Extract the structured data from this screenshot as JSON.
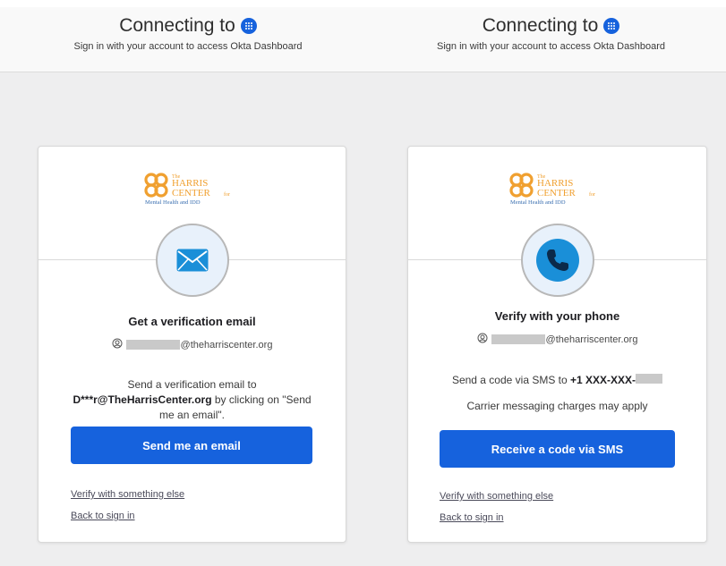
{
  "colors": {
    "accent": "#1662dd",
    "page_bg": "#eeeeef",
    "header_bg": "#f9f9f9"
  },
  "left": {
    "header": {
      "title": "Connecting to",
      "subtitle": "Sign in with your account to access Okta Dashboard",
      "icon": "okta-icon"
    },
    "logo": {
      "line1": "The",
      "line2": "HARRIS",
      "line3": "CENTER",
      "line3_suffix": "for",
      "line4": "Mental Health and IDD"
    },
    "factor_icon": "email-icon",
    "title": "Get a verification email",
    "identifier": {
      "icon": "user-icon",
      "domain": "@theharriscenter.org"
    },
    "description": {
      "prefix": "Send a verification email to ",
      "email": "D***r@TheHarrisCenter.org",
      "suffix": " by clicking on \"Send me an email\"."
    },
    "button_label": "Send me an email",
    "links": {
      "verify_else": "Verify with something else",
      "back": "Back to sign in"
    }
  },
  "right": {
    "header": {
      "title": "Connecting to",
      "subtitle": "Sign in with your account to access Okta Dashboard",
      "icon": "okta-icon"
    },
    "logo": {
      "line1": "The",
      "line2": "HARRIS",
      "line3": "CENTER",
      "line3_suffix": "for",
      "line4": "Mental Health and IDD"
    },
    "factor_icon": "phone-icon",
    "title": "Verify with your phone",
    "identifier": {
      "icon": "user-icon",
      "domain": "@theharriscenter.org"
    },
    "description": {
      "prefix": "Send a code via SMS to ",
      "phone": "+1 XXX-XXX-"
    },
    "note": "Carrier messaging charges may apply",
    "button_label": "Receive a code via SMS",
    "links": {
      "verify_else": "Verify with something else",
      "back": "Back to sign in"
    }
  }
}
